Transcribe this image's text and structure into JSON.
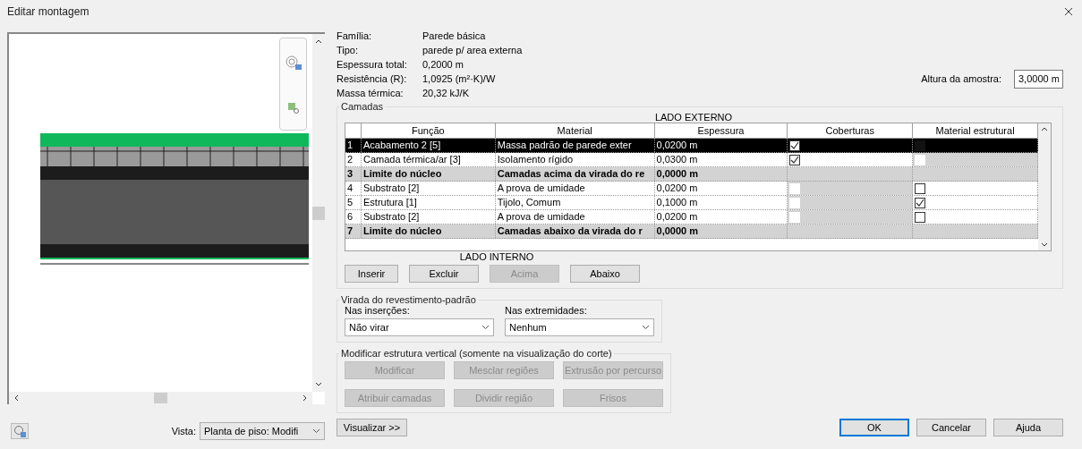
{
  "window": {
    "title": "Editar montagem"
  },
  "preview": {
    "kind": "picture",
    "view_label": "Vista:",
    "view_value": "Planta de piso: Modifi"
  },
  "properties": [
    {
      "label": "Família:",
      "value": "Parede básica"
    },
    {
      "label": "Tipo:",
      "value": "parede p/ area externa"
    },
    {
      "label": "Espessura total:",
      "value": "0,2000 m"
    },
    {
      "label": "Resistência (R):",
      "value": "1,0925 (m²·K)/W"
    },
    {
      "label": "Massa térmica:",
      "value": "20,32 kJ/K"
    }
  ],
  "sample_height": {
    "label": "Altura da amostra:",
    "value": "3,0000 m"
  },
  "layers": {
    "title": "Camadas",
    "top_label": "LADO EXTERNO",
    "bottom_label": "LADO INTERNO",
    "columns": [
      "Função",
      "Material",
      "Espessura",
      "Coberturas",
      "Material estrutural"
    ],
    "rows": [
      {
        "kind": "layer",
        "selected": true,
        "number": "1",
        "function": "Acabamento 2 [5]",
        "material": "Massa padrão de parede exter",
        "thickness": "0,0200 m",
        "wraps": {
          "checked": true,
          "disabled": false
        },
        "structural": {
          "checked": false,
          "disabled": true
        }
      },
      {
        "kind": "layer",
        "selected": false,
        "number": "2",
        "function": "Camada térmica/ar [3]",
        "material": "Isolamento rígido",
        "thickness": "0,0300 m",
        "wraps": {
          "checked": true,
          "disabled": false
        },
        "structural": {
          "checked": false,
          "disabled": true
        }
      },
      {
        "kind": "core_boundary",
        "selected": false,
        "number": "3",
        "function": "Limite do núcleo",
        "material": "Camadas acima da virada do re",
        "thickness": "0,0000 m"
      },
      {
        "kind": "layer",
        "selected": false,
        "number": "4",
        "function": "Substrato [2]",
        "material": "A prova de umidade",
        "thickness": "0,0200 m",
        "wraps": {
          "checked": false,
          "disabled": true
        },
        "structural": {
          "checked": false,
          "disabled": false
        }
      },
      {
        "kind": "layer",
        "selected": false,
        "number": "5",
        "function": "Estrutura [1]",
        "material": "Tijolo, Comum",
        "thickness": "0,1000 m",
        "wraps": {
          "checked": false,
          "disabled": true
        },
        "structural": {
          "checked": true,
          "disabled": false
        }
      },
      {
        "kind": "layer",
        "selected": false,
        "number": "6",
        "function": "Substrato [2]",
        "material": "A prova de umidade",
        "thickness": "0,0200 m",
        "wraps": {
          "checked": false,
          "disabled": true
        },
        "structural": {
          "checked": false,
          "disabled": false
        }
      },
      {
        "kind": "core_boundary",
        "selected": false,
        "number": "7",
        "function": "Limite do núcleo",
        "material": "Camadas abaixo da virada do r",
        "thickness": "0,0000 m"
      }
    ],
    "buttons": [
      {
        "label": "Inserir",
        "disabled": false
      },
      {
        "label": "Excluir",
        "disabled": false
      },
      {
        "label": "Acima",
        "disabled": true
      },
      {
        "label": "Abaixo",
        "disabled": false
      }
    ]
  },
  "wrapping": {
    "title": "Virada do revestimento-padrão",
    "fields": [
      {
        "label": "Nas inserções:",
        "value": "Não virar"
      },
      {
        "label": "Nas extremidades:",
        "value": "Nenhum"
      }
    ]
  },
  "vertical": {
    "title": "Modificar estrutura vertical (somente na visualização do corte)",
    "buttons": [
      {
        "label": "Modificar",
        "disabled": true
      },
      {
        "label": "Mesclar regiões",
        "disabled": true
      },
      {
        "label": "Extrusão por percurso",
        "disabled": true
      },
      {
        "label": "Atribuir camadas",
        "disabled": true
      },
      {
        "label": "Dividir região",
        "disabled": true
      },
      {
        "label": "Frisos",
        "disabled": true
      }
    ]
  },
  "preview_button": {
    "label": "Visualizar >>"
  },
  "footer_buttons": [
    {
      "label": "OK",
      "selected": true
    },
    {
      "label": "Cancelar",
      "selected": false
    },
    {
      "label": "Ajuda",
      "selected": false
    }
  ]
}
